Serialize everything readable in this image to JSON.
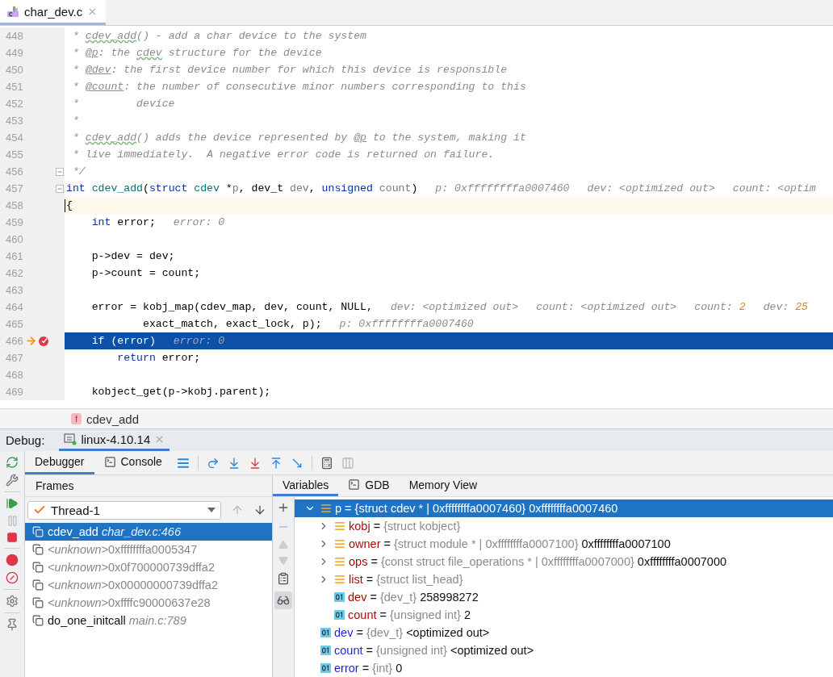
{
  "editor_tab": {
    "label": "char_dev.c",
    "selected": true
  },
  "code_lines": [
    {
      "number": "448",
      "current_line": false,
      "execution_point": false,
      "fold": false,
      "tokens": [
        {
          "text": " * ",
          "kind": "comment"
        },
        {
          "text": "cdev_add",
          "kind": "typo"
        },
        {
          "text": "() - add a char device to the system",
          "kind": "comment"
        }
      ]
    },
    {
      "number": "449",
      "current_line": false,
      "execution_point": false,
      "fold": false,
      "tokens": [
        {
          "text": " * ",
          "kind": "comment"
        },
        {
          "text": "@p",
          "kind": "tag"
        },
        {
          "text": ": the ",
          "kind": "comment"
        },
        {
          "text": "cdev",
          "kind": "typo"
        },
        {
          "text": " structure for the device",
          "kind": "comment"
        }
      ]
    },
    {
      "number": "450",
      "current_line": false,
      "execution_point": false,
      "fold": false,
      "tokens": [
        {
          "text": " * ",
          "kind": "comment"
        },
        {
          "text": "@dev",
          "kind": "tag"
        },
        {
          "text": ": the first device number for which this device is responsible",
          "kind": "comment"
        }
      ]
    },
    {
      "number": "451",
      "current_line": false,
      "execution_point": false,
      "fold": false,
      "tokens": [
        {
          "text": " * ",
          "kind": "comment"
        },
        {
          "text": "@count",
          "kind": "tag"
        },
        {
          "text": ": the number of consecutive minor numbers corresponding to this",
          "kind": "comment"
        }
      ]
    },
    {
      "number": "452",
      "current_line": false,
      "execution_point": false,
      "fold": false,
      "tokens": [
        {
          "text": " *         device",
          "kind": "comment"
        }
      ]
    },
    {
      "number": "453",
      "current_line": false,
      "execution_point": false,
      "fold": false,
      "tokens": [
        {
          "text": " *",
          "kind": "comment"
        }
      ]
    },
    {
      "number": "454",
      "current_line": false,
      "execution_point": false,
      "fold": false,
      "tokens": [
        {
          "text": " * ",
          "kind": "comment"
        },
        {
          "text": "cdev_add",
          "kind": "typo"
        },
        {
          "text": "() adds the device represented by ",
          "kind": "comment"
        },
        {
          "text": "@p",
          "kind": "tag"
        },
        {
          "text": " to the system, making it",
          "kind": "comment"
        }
      ]
    },
    {
      "number": "455",
      "current_line": false,
      "execution_point": false,
      "fold": false,
      "tokens": [
        {
          "text": " * live immediately.  A negative error code is returned on failure.",
          "kind": "comment"
        }
      ]
    },
    {
      "number": "456",
      "current_line": false,
      "execution_point": false,
      "fold": true,
      "tokens": [
        {
          "text": " */",
          "kind": "comment"
        }
      ]
    },
    {
      "number": "457",
      "current_line": false,
      "execution_point": false,
      "fold": true,
      "tokens": [
        {
          "text": "int ",
          "kind": "keyword"
        },
        {
          "text": "cdev_add",
          "kind": "function"
        },
        {
          "text": "(",
          "kind": "plain"
        },
        {
          "text": "struct ",
          "kind": "keyword"
        },
        {
          "text": "cdev",
          "kind": "function"
        },
        {
          "text": " *",
          "kind": "plain"
        },
        {
          "text": "p",
          "kind": "param"
        },
        {
          "text": ", dev_t ",
          "kind": "plain"
        },
        {
          "text": "dev",
          "kind": "param"
        },
        {
          "text": ", ",
          "kind": "plain"
        },
        {
          "text": "unsigned ",
          "kind": "keyword"
        },
        {
          "text": "count",
          "kind": "param"
        },
        {
          "text": ")",
          "kind": "plain"
        }
      ],
      "hints": [
        {
          "label": "p:",
          "value": "0xffffffffa0007460",
          "changed": false
        },
        {
          "label": "dev:",
          "value": "<optimized out>",
          "changed": false
        },
        {
          "label": "count:",
          "value": "<optim",
          "changed": false
        }
      ]
    },
    {
      "number": "458",
      "current_line": true,
      "execution_point": false,
      "fold": false,
      "tokens": [
        {
          "text": "{",
          "kind": "plain"
        }
      ]
    },
    {
      "number": "459",
      "current_line": false,
      "execution_point": false,
      "fold": false,
      "tokens": [
        {
          "text": "    int",
          "kind": "keyword"
        },
        {
          "text": " error;",
          "kind": "plain"
        }
      ],
      "hints": [
        {
          "label": "error:",
          "value": "0",
          "changed": false
        }
      ]
    },
    {
      "number": "460",
      "current_line": false,
      "execution_point": false,
      "fold": false
    },
    {
      "number": "461",
      "current_line": false,
      "execution_point": false,
      "fold": false,
      "tokens": [
        {
          "text": "    p->dev = dev;",
          "kind": "plain"
        }
      ]
    },
    {
      "number": "462",
      "current_line": false,
      "execution_point": false,
      "fold": false,
      "tokens": [
        {
          "text": "    p->count = count;",
          "kind": "plain"
        }
      ]
    },
    {
      "number": "463",
      "current_line": false,
      "execution_point": false,
      "fold": false
    },
    {
      "number": "464",
      "current_line": false,
      "execution_point": false,
      "fold": false,
      "tokens": [
        {
          "text": "    error = kobj_map(cdev_map, dev, count, NULL,",
          "kind": "plain"
        }
      ],
      "hints": [
        {
          "label": "dev:",
          "value": "<optimized out>",
          "changed": false
        },
        {
          "label": "count:",
          "value": "<optimized out>",
          "changed": false
        },
        {
          "label": "count:",
          "value": "2",
          "changed": true
        },
        {
          "label": "dev:",
          "value": "25",
          "changed": true
        }
      ]
    },
    {
      "number": "465",
      "current_line": false,
      "execution_point": false,
      "fold": false,
      "tokens": [
        {
          "text": "            exact_match, exact_lock, p);",
          "kind": "plain"
        }
      ],
      "hints": [
        {
          "label": "p:",
          "value": "0xffffffffa0007460",
          "changed": false
        }
      ]
    },
    {
      "number": "466",
      "current_line": false,
      "execution_point": true,
      "fold": false,
      "tokens": [
        {
          "text": "    if",
          "kind": "keyword"
        },
        {
          "text": " (error)",
          "kind": "plain"
        }
      ],
      "hints": [
        {
          "label": "error:",
          "value": "0",
          "changed": false
        }
      ]
    },
    {
      "number": "467",
      "current_line": false,
      "execution_point": false,
      "fold": false,
      "tokens": [
        {
          "text": "        return",
          "kind": "keyword"
        },
        {
          "text": " error;",
          "kind": "plain"
        }
      ]
    },
    {
      "number": "468",
      "current_line": false,
      "execution_point": false,
      "fold": false
    },
    {
      "number": "469",
      "current_line": false,
      "execution_point": false,
      "fold": false,
      "tokens": [
        {
          "text": "    kobject_get(p->kobj.parent);",
          "kind": "plain"
        }
      ]
    }
  ],
  "breadcrumb": {
    "badge": "f",
    "label": "cdev_add"
  },
  "debug": {
    "title": "Debug:",
    "session_tab": {
      "label": "linux-4.10.14",
      "selected": true
    }
  },
  "debug_tabs": [
    {
      "label": "Debugger",
      "kind": "plain",
      "selected": true
    },
    {
      "label": "Console",
      "kind": "console",
      "selected": false
    }
  ],
  "frames": {
    "title": "Frames",
    "thread": "Thread-1",
    "items": [
      {
        "kind": "source",
        "function": "cdev_add",
        "location": "char_dev.c:466",
        "selected": true
      },
      {
        "kind": "unknown",
        "function": "<unknown>",
        "location": "0xffffffffa0005347",
        "selected": false
      },
      {
        "kind": "unknown",
        "function": "<unknown>",
        "location": "0x0f700000739dffa2",
        "selected": false
      },
      {
        "kind": "unknown",
        "function": "<unknown>",
        "location": "0x00000000739dffa2",
        "selected": false
      },
      {
        "kind": "unknown",
        "function": "<unknown>",
        "location": "0xffffc90000637e28",
        "selected": false
      },
      {
        "kind": "source",
        "function": "do_one_initcall",
        "location": "main.c:789",
        "selected": false
      }
    ]
  },
  "variable_tabs": [
    {
      "label": "Variables",
      "kind": "plain",
      "selected": true
    },
    {
      "label": "GDB",
      "kind": "console",
      "selected": false
    },
    {
      "label": "Memory View",
      "kind": "plain",
      "selected": false
    }
  ],
  "variables": [
    {
      "name": "p",
      "sign": "=",
      "type": "{struct cdev * | 0xffffffffa0007460}",
      "value": "0xffffffffa0007460",
      "kind": "struct",
      "expanded": true,
      "selected": true,
      "children": [
        {
          "name": "kobj",
          "sign": "=",
          "type": "{struct kobject}",
          "kind": "struct",
          "expanded": false,
          "selected": false
        },
        {
          "name": "owner",
          "sign": "=",
          "type": "{struct module * | 0xffffffffa0007100}",
          "value": "0xffffffffa0007100",
          "kind": "struct",
          "expanded": false,
          "selected": false
        },
        {
          "name": "ops",
          "sign": "=",
          "type": "{const struct file_operations * | 0xffffffffa0007000}",
          "value": "0xffffffffa0007000",
          "kind": "struct",
          "expanded": false,
          "selected": false
        },
        {
          "name": "list",
          "sign": "=",
          "type": "{struct list_head}",
          "kind": "struct",
          "expanded": false,
          "selected": false
        },
        {
          "name": "dev",
          "sign": "=",
          "type": "{dev_t}",
          "value": "258998272",
          "kind": "primitive",
          "selected": false
        },
        {
          "name": "count",
          "sign": "=",
          "type": "{unsigned int}",
          "value": "2",
          "kind": "primitive",
          "selected": false
        }
      ]
    },
    {
      "name": "dev",
      "sign": "=",
      "type": "{dev_t}",
      "value": "<optimized out>",
      "kind": "primitive",
      "selected": false
    },
    {
      "name": "count",
      "sign": "=",
      "type": "{unsigned int}",
      "value": "<optimized out>",
      "kind": "primitive",
      "selected": false
    },
    {
      "name": "error",
      "sign": "=",
      "type": "{int}",
      "value": "0",
      "kind": "primitive",
      "selected": false
    }
  ]
}
